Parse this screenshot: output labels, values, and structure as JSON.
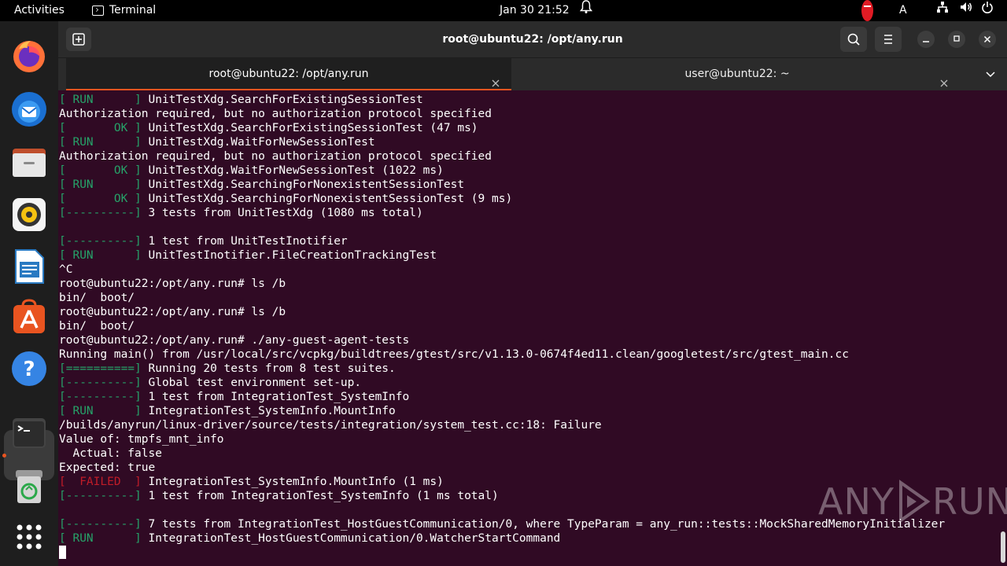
{
  "topbar": {
    "activities": "Activities",
    "app_name": "Terminal",
    "clock": "Jan 30  21:52",
    "keyboard_indicator": "A"
  },
  "dock": {
    "items": [
      "firefox-icon",
      "thunderbird-icon",
      "files-icon",
      "rhythmbox-icon",
      "libreoffice-writer-icon",
      "app-center-icon",
      "help-icon",
      "terminal-icon",
      "trash-icon",
      "show-apps-icon"
    ]
  },
  "window": {
    "title": "root@ubuntu22: /opt/any.run",
    "tabs": [
      {
        "label": "root@ubuntu22: /opt/any.run",
        "active": true
      },
      {
        "label": "user@ubuntu22: ~",
        "active": false
      }
    ]
  },
  "terminal": {
    "lines": [
      {
        "prefix": "[ RUN      ]",
        "pc": "g",
        "text": " UnitTestXdg.SearchForExistingSessionTest"
      },
      {
        "prefix": "",
        "pc": "",
        "text": "Authorization required, but no authorization protocol specified"
      },
      {
        "prefix": "[       OK ]",
        "pc": "g",
        "text": " UnitTestXdg.SearchForExistingSessionTest (47 ms)"
      },
      {
        "prefix": "[ RUN      ]",
        "pc": "g",
        "text": " UnitTestXdg.WaitForNewSessionTest"
      },
      {
        "prefix": "",
        "pc": "",
        "text": "Authorization required, but no authorization protocol specified"
      },
      {
        "prefix": "[       OK ]",
        "pc": "g",
        "text": " UnitTestXdg.WaitForNewSessionTest (1022 ms)"
      },
      {
        "prefix": "[ RUN      ]",
        "pc": "g",
        "text": " UnitTestXdg.SearchingForNonexistentSessionTest"
      },
      {
        "prefix": "[       OK ]",
        "pc": "g",
        "text": " UnitTestXdg.SearchingForNonexistentSessionTest (9 ms)"
      },
      {
        "prefix": "[----------]",
        "pc": "g",
        "text": " 3 tests from UnitTestXdg (1080 ms total)"
      },
      {
        "prefix": "",
        "pc": "",
        "text": ""
      },
      {
        "prefix": "[----------]",
        "pc": "g",
        "text": " 1 test from UnitTestInotifier"
      },
      {
        "prefix": "[ RUN      ]",
        "pc": "g",
        "text": " UnitTestInotifier.FileCreationTrackingTest"
      },
      {
        "prefix": "",
        "pc": "",
        "text": "^C"
      },
      {
        "prefix": "",
        "pc": "",
        "text": "root@ubuntu22:/opt/any.run# ls /b"
      },
      {
        "prefix": "",
        "pc": "",
        "text": "bin/  boot/"
      },
      {
        "prefix": "",
        "pc": "",
        "text": "root@ubuntu22:/opt/any.run# ls /b"
      },
      {
        "prefix": "",
        "pc": "",
        "text": "bin/  boot/"
      },
      {
        "prefix": "",
        "pc": "",
        "text": "root@ubuntu22:/opt/any.run# ./any-guest-agent-tests"
      },
      {
        "prefix": "",
        "pc": "",
        "text": "Running main() from /usr/local/src/vcpkg/buildtrees/gtest/src/v1.13.0-0674f4ed11.clean/googletest/src/gtest_main.cc"
      },
      {
        "prefix": "[==========]",
        "pc": "g",
        "text": " Running 20 tests from 8 test suites."
      },
      {
        "prefix": "[----------]",
        "pc": "g",
        "text": " Global test environment set-up."
      },
      {
        "prefix": "[----------]",
        "pc": "g",
        "text": " 1 test from IntegrationTest_SystemInfo"
      },
      {
        "prefix": "[ RUN      ]",
        "pc": "g",
        "text": " IntegrationTest_SystemInfo.MountInfo"
      },
      {
        "prefix": "",
        "pc": "",
        "text": "/builds/anyrun/linux-driver/source/tests/integration/system_test.cc:18: Failure"
      },
      {
        "prefix": "",
        "pc": "",
        "text": "Value of: tmpfs_mnt_info"
      },
      {
        "prefix": "",
        "pc": "",
        "text": "  Actual: false"
      },
      {
        "prefix": "",
        "pc": "",
        "text": "Expected: true"
      },
      {
        "prefix": "[  FAILED  ]",
        "pc": "r",
        "text": " IntegrationTest_SystemInfo.MountInfo (1 ms)"
      },
      {
        "prefix": "[----------]",
        "pc": "g",
        "text": " 1 test from IntegrationTest_SystemInfo (1 ms total)"
      },
      {
        "prefix": "",
        "pc": "",
        "text": ""
      },
      {
        "prefix": "[----------]",
        "pc": "g",
        "text": " 7 tests from IntegrationTest_HostGuestCommunication/0, where TypeParam = any_run::tests::MockSharedMemoryInitializer"
      },
      {
        "prefix": "[ RUN      ]",
        "pc": "g",
        "text": " IntegrationTest_HostGuestCommunication/0.WatcherStartCommand"
      }
    ]
  },
  "watermark": {
    "left": "ANY",
    "right": "RUN"
  },
  "colors": {
    "accent": "#e95420",
    "terminal_bg": "#300a24",
    "pass": "#26a269",
    "fail": "#c01c28"
  }
}
